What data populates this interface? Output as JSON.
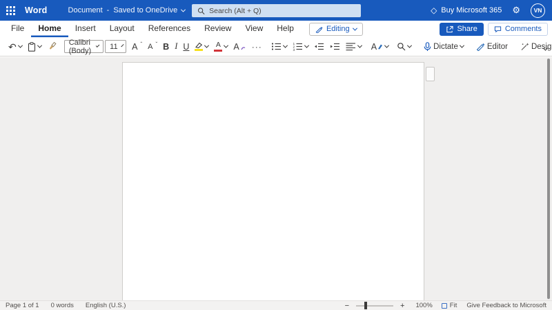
{
  "colors": {
    "brand_blue": "#185abd",
    "toolbar_icon": "#3b3a39",
    "highlight_yellow": "#f7e01d",
    "font_color_red": "#d13438",
    "canvas_grey": "#f0efee"
  },
  "titlebar": {
    "app_name": "Word",
    "doc_name": "Document",
    "separator": "-",
    "save_status": "Saved to OneDrive",
    "search_placeholder": "Search (Alt + Q)",
    "buy_label": "Buy Microsoft 365",
    "diamond_glyph": "◇",
    "gear_glyph": "⚙",
    "avatar_initials": "VN"
  },
  "menubar": {
    "tabs": [
      "File",
      "Home",
      "Insert",
      "Layout",
      "References",
      "Review",
      "View",
      "Help"
    ],
    "active_tab": "Home",
    "editing_label": "Editing",
    "share_label": "Share",
    "comments_label": "Comments"
  },
  "toolbar": {
    "undo_glyph": "↶",
    "font_name": "Calibri (Body)",
    "font_size": "11",
    "grow_font_letter": "A",
    "shrink_font_letter": "A",
    "grow_mark": "ˆ",
    "shrink_mark": "ˇ",
    "bold_letter": "B",
    "italic_letter": "I",
    "underline_letter": "U",
    "font_color_letter": "A",
    "text_effects_letter": "A",
    "styles_letter": "A",
    "more_fonts": "···",
    "dictate_label": "Dictate",
    "editor_label": "Editor",
    "designer_label": "Designer",
    "more_commands": "···"
  },
  "statusbar": {
    "page_count": "Page 1 of 1",
    "word_count": "0 words",
    "language": "English (U.S.)",
    "zoom_minus": "−",
    "zoom_plus": "+",
    "zoom_level": "100%",
    "fit_label": "Fit",
    "feedback": "Give Feedback to Microsoft"
  }
}
